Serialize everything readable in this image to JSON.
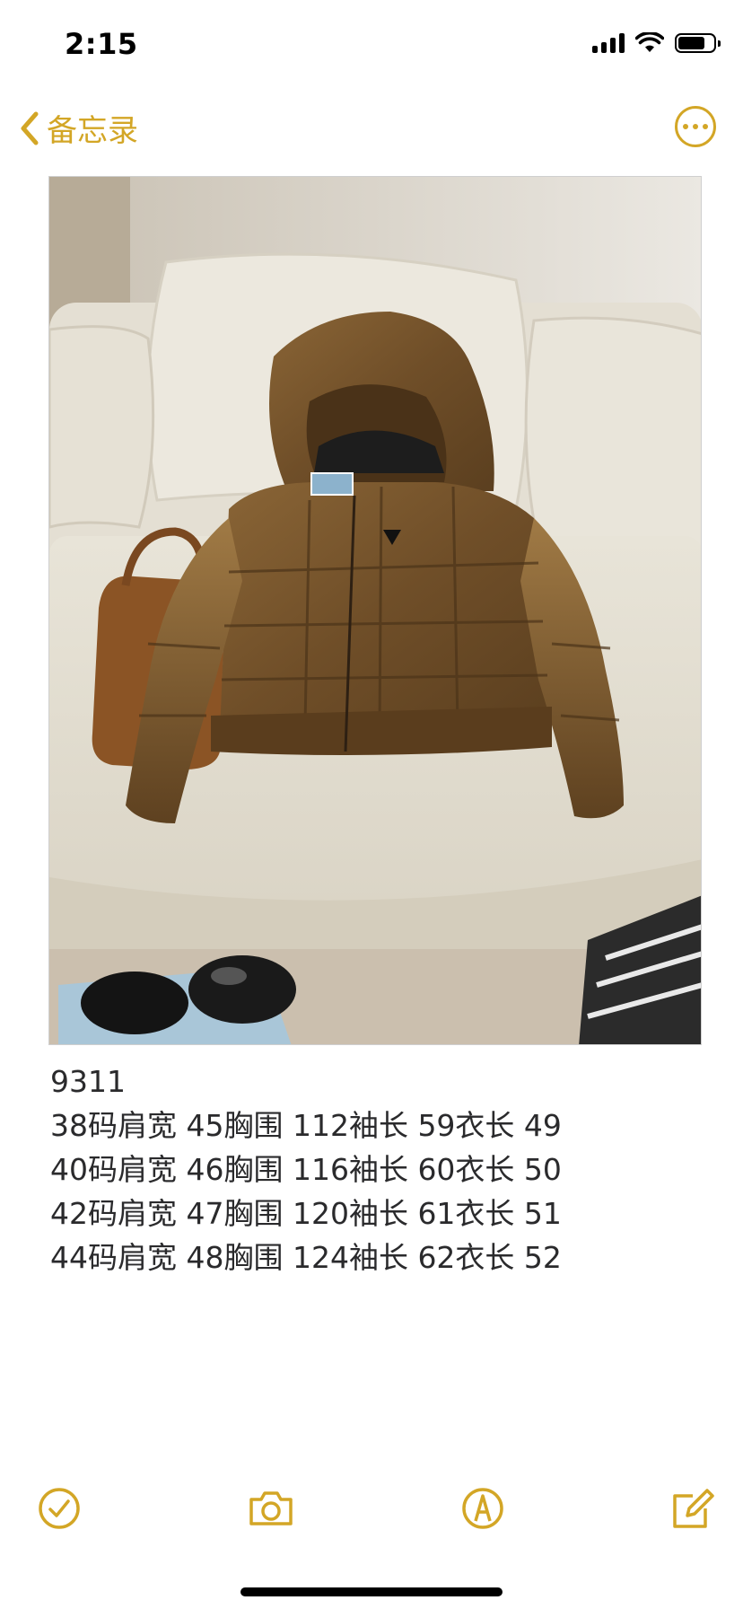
{
  "status_bar": {
    "time": "2:15"
  },
  "nav": {
    "back_label": "备忘录"
  },
  "photo": {
    "description_icon": "jacket-photo"
  },
  "note": {
    "title": "9311",
    "lines": [
      "38码肩宽 45胸围 112袖长 59衣长 49",
      "40码肩宽 46胸围 116袖长 60衣长 50",
      "42码肩宽 47胸围 120袖长 61衣长 51",
      "44码肩宽 48胸围 124袖长 62衣长 52"
    ]
  },
  "toolbar": {
    "items": [
      "checklist-icon",
      "camera-icon",
      "markup-icon",
      "compose-icon"
    ]
  },
  "colors": {
    "accent": "#d3a626",
    "text": "#2a2a2c"
  }
}
